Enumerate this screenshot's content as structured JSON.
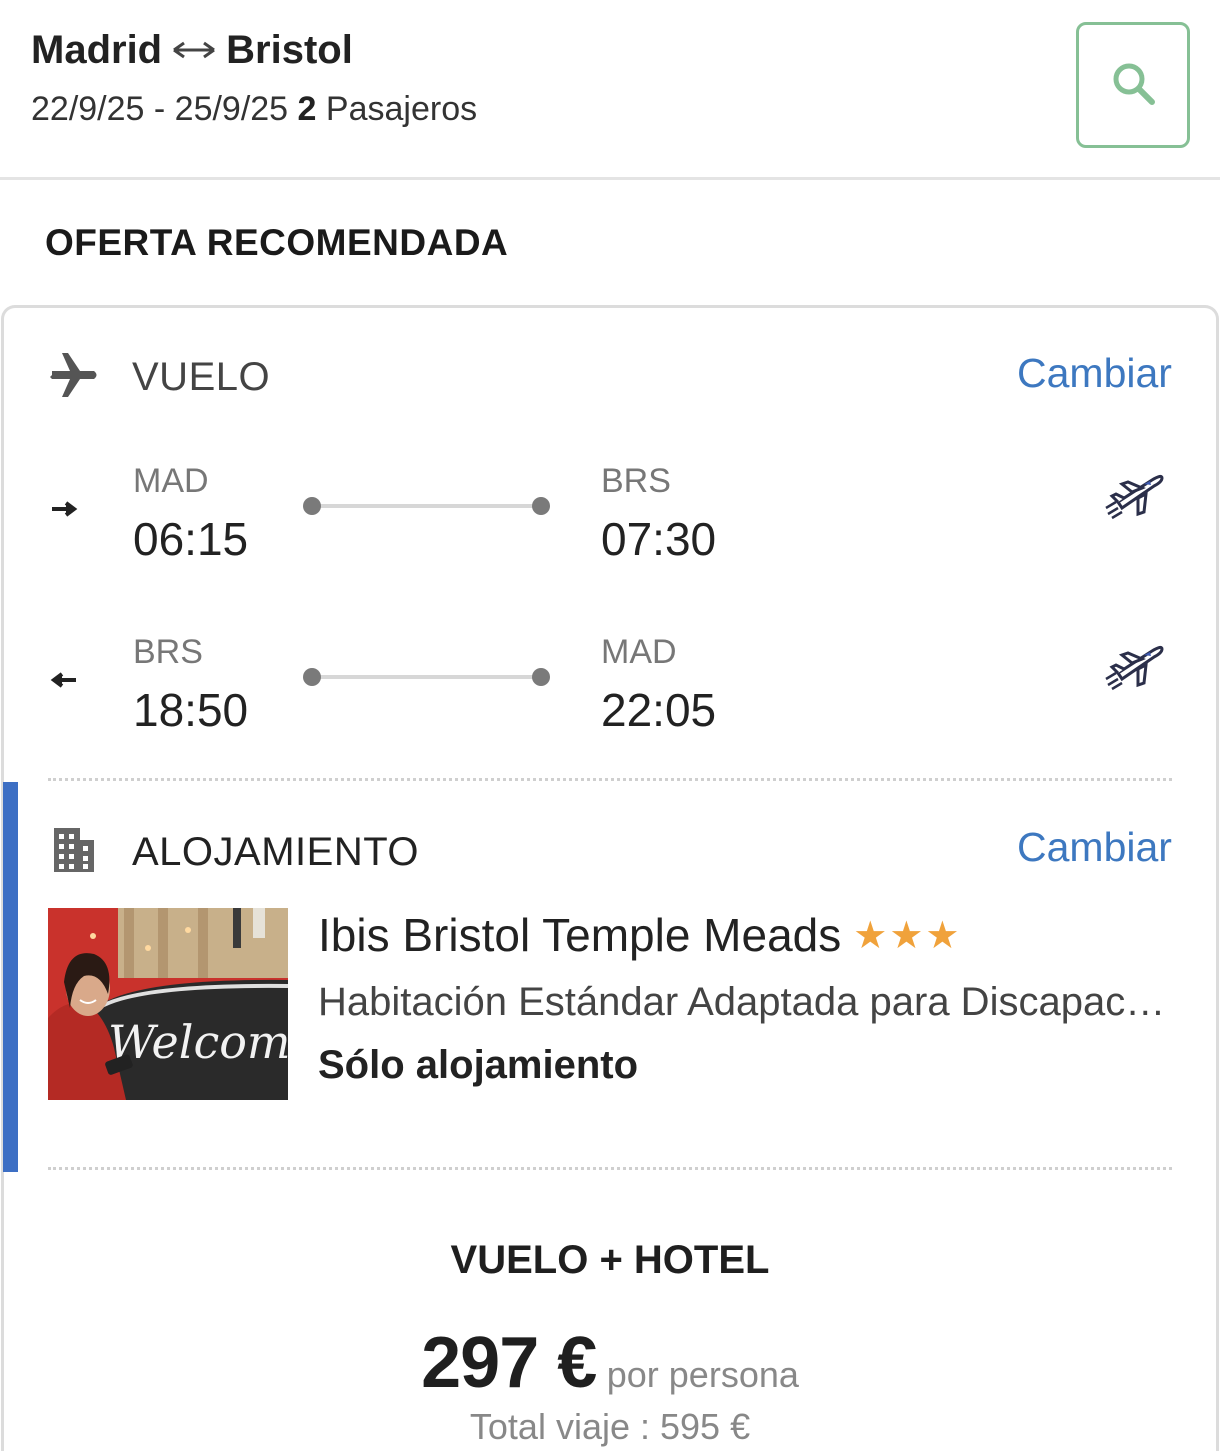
{
  "header": {
    "origin": "Madrid",
    "route_arrow": "↔",
    "destination": "Bristol",
    "dates": "22/9/25 - 25/9/25",
    "passengers_count": "2",
    "passengers_label": "Pasajeros"
  },
  "offer": {
    "title": "OFERTA RECOMENDADA"
  },
  "flight": {
    "label": "VUELO",
    "change_label": "Cambiar",
    "legs": [
      {
        "direction": "outbound",
        "from_code": "MAD",
        "from_time": "06:15",
        "to_code": "BRS",
        "to_time": "07:30"
      },
      {
        "direction": "return",
        "from_code": "BRS",
        "from_time": "18:50",
        "to_code": "MAD",
        "to_time": "22:05"
      }
    ]
  },
  "accommodation": {
    "label": "ALOJAMIENTO",
    "change_label": "Cambiar",
    "hotel_name": "Ibis Bristol Temple Meads",
    "stars": "★★★",
    "star_count": 3,
    "room": "Habitación Estándar Adaptada para Discapacitados",
    "regime": "Sólo alojamiento",
    "photo_sign": "Welcome"
  },
  "package": {
    "title": "VUELO + HOTEL",
    "price": "297 €",
    "per_person": "por persona",
    "total": "Total viaje : 595 €"
  },
  "colors": {
    "accent_blue": "#3d78c0",
    "search_border": "#86c095",
    "star": "#f0a23b",
    "accent_bar": "#3d6fc4"
  },
  "icons": {
    "search": "search-icon",
    "flight": "airplane-icon",
    "hotel": "building-icon",
    "outbound": "arrow-right-icon",
    "return": "arrow-left-icon",
    "airline": "airline-plane-icon"
  }
}
